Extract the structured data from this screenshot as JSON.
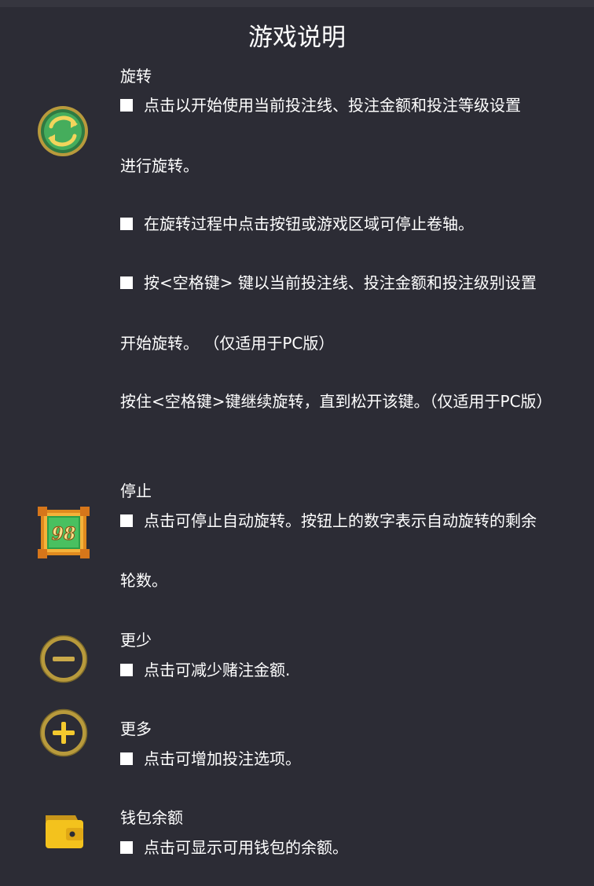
{
  "title": "游戏说明",
  "sections": {
    "spin": {
      "icon": "spin-icon",
      "heading": "旋转",
      "lines": [
        "点击以开始使用当前投注线、投注金额和投注等级设置",
        "进行旋转。",
        "在旋转过程中点击按钮或游戏区域可停止卷轴。",
        "按<空格键> 键以当前投注线、投注金额和投注级别设置",
        "开始旋转。 （仅适用于PC版）",
        "按住<空格键>键继续旋转，直到松开该键。（仅适用于PC版）"
      ]
    },
    "stop": {
      "icon": "autospin-counter-icon",
      "icon_number": "98",
      "heading": "停止",
      "lines": [
        "点击可停止自动旋转。按钮上的数字表示自动旋转的剩余",
        "轮数。"
      ]
    },
    "less": {
      "icon": "minus-icon",
      "heading": "更少",
      "lines": [
        "点击可减少赌注金额."
      ]
    },
    "more": {
      "icon": "plus-icon",
      "heading": "更多",
      "lines": [
        "点击可增加投注选项。"
      ]
    },
    "wallet": {
      "icon": "wallet-icon",
      "heading": "钱包余额",
      "lines": [
        "点击可显示可用钱包的余额。"
      ]
    }
  },
  "colors": {
    "background": "#2c2c35",
    "text": "#ffffff",
    "gold": "#b89a3c",
    "spin_green": "#3b9a50",
    "wallet_yellow": "#f3c21d"
  }
}
